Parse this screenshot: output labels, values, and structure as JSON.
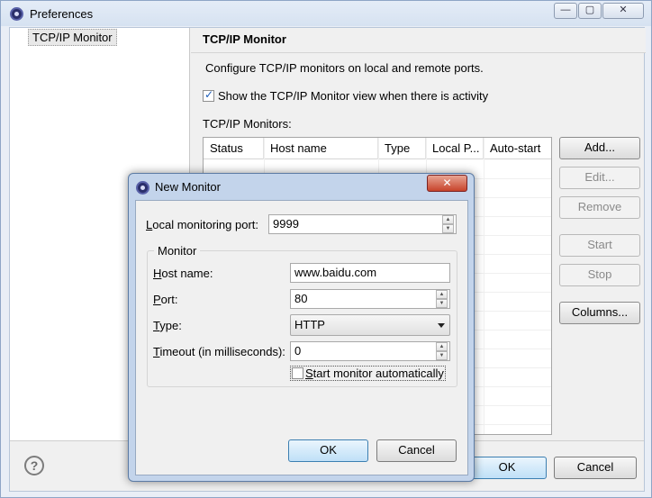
{
  "preferences": {
    "title": "Preferences",
    "window_buttons": {
      "minimize": "—",
      "maximize": "▢",
      "close": "✕"
    },
    "nav": {
      "selected_item": "TCP/IP Monitor"
    },
    "page": {
      "title": "TCP/IP Monitor",
      "description": "Configure TCP/IP monitors on local and remote ports.",
      "show_view_label": "Show the TCP/IP Monitor view when there is activity",
      "show_view_checked": true,
      "monitors_label": "TCP/IP Monitors:",
      "table_columns": [
        "Status",
        "Host name",
        "Type",
        "Local P...",
        "Auto-start"
      ],
      "buttons": {
        "add": "Add...",
        "edit": "Edit...",
        "remove": "Remove",
        "start": "Start",
        "stop": "Stop",
        "columns": "Columns..."
      }
    },
    "help_icon_glyph": "?",
    "ok": "OK",
    "cancel": "Cancel"
  },
  "new_monitor": {
    "title": "New Monitor",
    "close_glyph": "✕",
    "local_port": {
      "label_u": "L",
      "label_rest": "ocal monitoring port:",
      "value": "9999"
    },
    "group_label": "Monitor",
    "host": {
      "label_u": "H",
      "label_rest": "ost name:",
      "value": "www.baidu.com"
    },
    "port": {
      "label_u": "P",
      "label_rest": "ort:",
      "value": "80"
    },
    "type": {
      "label_u": "T",
      "label_rest": "ype:",
      "value": "HTTP"
    },
    "timeout": {
      "label_u": "T",
      "label_rest": "imeout (in milliseconds):",
      "value": "0"
    },
    "auto_start": {
      "label_u": "S",
      "label_rest": "tart monitor automatically",
      "checked": false
    },
    "ok": "OK",
    "cancel": "Cancel"
  }
}
